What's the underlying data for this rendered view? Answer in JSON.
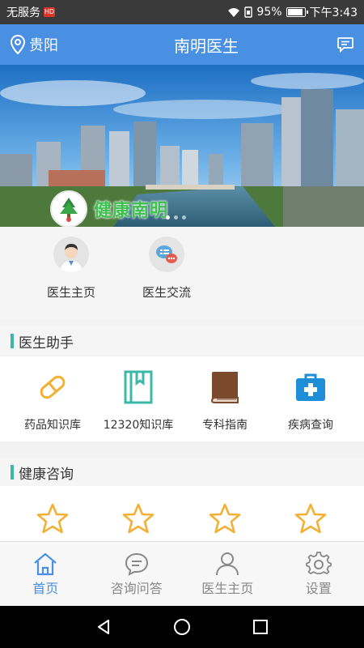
{
  "status": {
    "carrier": "无服务",
    "carrier_badge": "HD",
    "battery": "95%",
    "battery_level": 0.95,
    "time": "下午3:43"
  },
  "appbar": {
    "city": "贵阳",
    "title": "南明医生",
    "accent": "#4a90e2"
  },
  "banner": {
    "slogan": "健康南明"
  },
  "quick": [
    {
      "label": "医生主页",
      "icon": "doctor-avatar-icon"
    },
    {
      "label": "医生交流",
      "icon": "chat-bubbles-icon"
    }
  ],
  "sections": {
    "assistant": "医生助手",
    "consult": "健康咨询"
  },
  "tools": [
    {
      "label": "药品知识库",
      "icon": "pill-icon"
    },
    {
      "label": "12320知识库",
      "icon": "bookmark-book-icon"
    },
    {
      "label": "专科指南",
      "icon": "book-icon"
    },
    {
      "label": "疾病查询",
      "icon": "medical-kit-icon"
    }
  ],
  "consult_items": [
    "star-icon",
    "star-icon",
    "star-icon",
    "star-icon"
  ],
  "tabs": [
    {
      "label": "首页",
      "icon": "home-icon",
      "active": true
    },
    {
      "label": "咨询问答",
      "icon": "chat-icon",
      "active": false
    },
    {
      "label": "医生主页",
      "icon": "person-icon",
      "active": false
    },
    {
      "label": "设置",
      "icon": "gear-icon",
      "active": false
    }
  ]
}
